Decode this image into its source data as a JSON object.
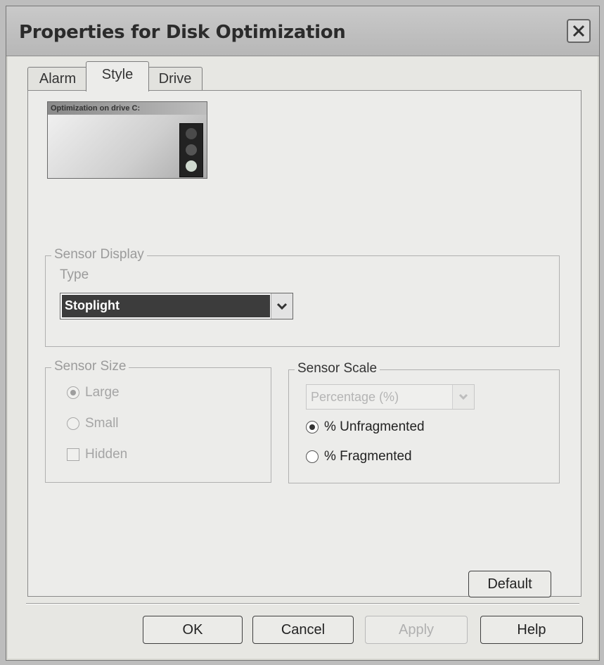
{
  "window": {
    "title": "Properties for Disk Optimization"
  },
  "tabs": [
    {
      "label": "Alarm",
      "active": false
    },
    {
      "label": "Style",
      "active": true
    },
    {
      "label": "Drive",
      "active": false
    }
  ],
  "preview": {
    "header": "Optimization on drive C:"
  },
  "sensor_display": {
    "legend": "Sensor Display",
    "type_label": "Type",
    "type_value": "Stoplight"
  },
  "sensor_size": {
    "legend": "Sensor Size",
    "options": [
      {
        "label": "Large",
        "checked": true
      },
      {
        "label": "Small",
        "checked": false
      }
    ],
    "hidden_label": "Hidden",
    "hidden_checked": false
  },
  "sensor_scale": {
    "legend": "Sensor Scale",
    "select_value": "Percentage (%)",
    "options": [
      {
        "label": "% Unfragmented",
        "checked": true
      },
      {
        "label": "% Fragmented",
        "checked": false
      }
    ]
  },
  "buttons": {
    "default": "Default",
    "ok": "OK",
    "cancel": "Cancel",
    "apply": "Apply",
    "help": "Help"
  },
  "colors": {
    "selection": "#3c3c3c",
    "disabled_text": "#a5a5a5",
    "light_green": "#9ecf9e",
    "light_off": "#5a5a5a"
  }
}
